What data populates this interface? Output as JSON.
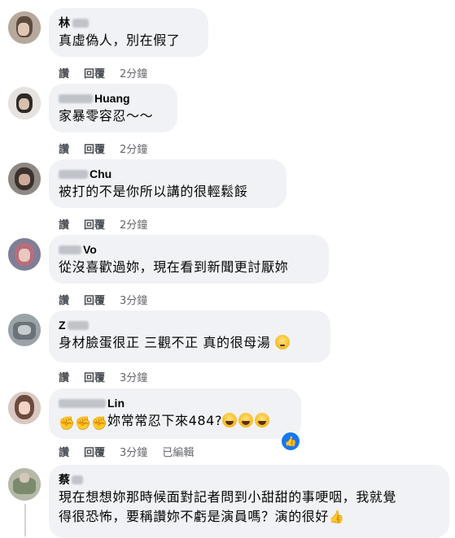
{
  "comments": [
    {
      "name": "林",
      "text": "真虛偽人，別在假了",
      "like": "讚",
      "reply": "回覆",
      "time": "2分鐘"
    },
    {
      "name": "Huang",
      "text": "家暴零容忍～～",
      "like": "讚",
      "reply": "回覆",
      "time": "2分鐘"
    },
    {
      "name": "Chu",
      "text": "被打的不是你所以講的很輕鬆餒",
      "like": "讚",
      "reply": "回覆",
      "time": "2分鐘"
    },
    {
      "name": "Vo",
      "text": "從沒喜歡過妳，現在看到新聞更討厭妳",
      "like": "讚",
      "reply": "回覆",
      "time": "3分鐘"
    },
    {
      "name": "Z",
      "text": "身材臉蛋很正 三觀不正 真的很母湯",
      "like": "讚",
      "reply": "回覆",
      "time": "3分鐘"
    },
    {
      "name": "Lin",
      "text": "妳常常忍下來484?",
      "like": "讚",
      "reply": "回覆",
      "time": "3分鐘",
      "edited": "已編輯"
    },
    {
      "name": "蔡",
      "text_line1": "現在想想妳那時候面對記者問到小甜甜的事哽咽，我就覺",
      "text_line2": "得很恐怖，要稱讚妳不虧是演員嗎？演的很好"
    }
  ],
  "icons": {
    "fist": "oncoming-fist-emoji",
    "laugh": "grinning-tears-emoji",
    "rolling_eyes": "rolling-eyes-emoji",
    "like_badge": "thumbs-up-badge",
    "thumb": "thumbs-up-emoji"
  },
  "colors": {
    "bubble": "#f0f2f5",
    "like_blue": "#1877f2",
    "meta": "#65676b"
  }
}
